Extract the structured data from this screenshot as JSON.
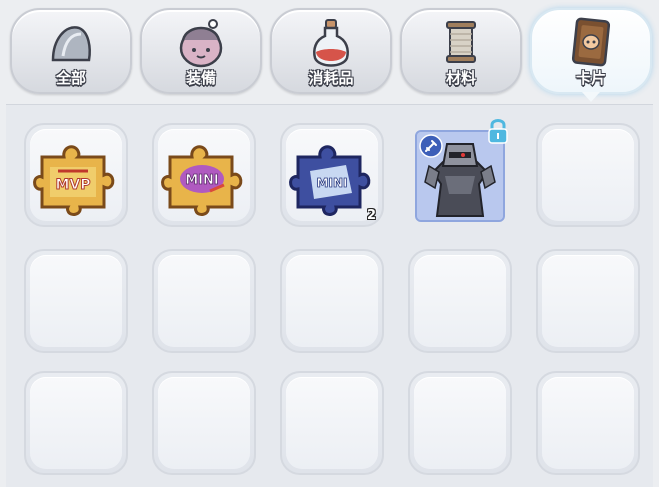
{
  "tabs": [
    {
      "label": "全部",
      "icon": "all-items-icon",
      "active": false
    },
    {
      "label": "装備",
      "icon": "equipment-icon",
      "active": false
    },
    {
      "label": "消耗品",
      "icon": "potion-icon",
      "active": false
    },
    {
      "label": "材料",
      "icon": "thread-spool-icon",
      "active": false
    },
    {
      "label": "卡片",
      "icon": "card-icon",
      "active": true
    }
  ],
  "items": [
    {
      "name": "MVP card puzzle piece",
      "icon": "mvp-puzzle-icon",
      "count": ""
    },
    {
      "name": "MINI card puzzle piece",
      "icon": "mini-puzzle-icon",
      "count": ""
    },
    {
      "name": "MINI card puzzle piece blue",
      "icon": "blue-mini-puzzle-icon",
      "count": "2"
    },
    {
      "name": "Armored knight card",
      "icon": "knight-card-icon",
      "count": "",
      "locked": true
    }
  ],
  "colors": {
    "background": "#eceef1",
    "tab_label_outline": "#3c3f4a",
    "card_frame": "#b6c6ec",
    "lock": "#4fb8e0"
  }
}
